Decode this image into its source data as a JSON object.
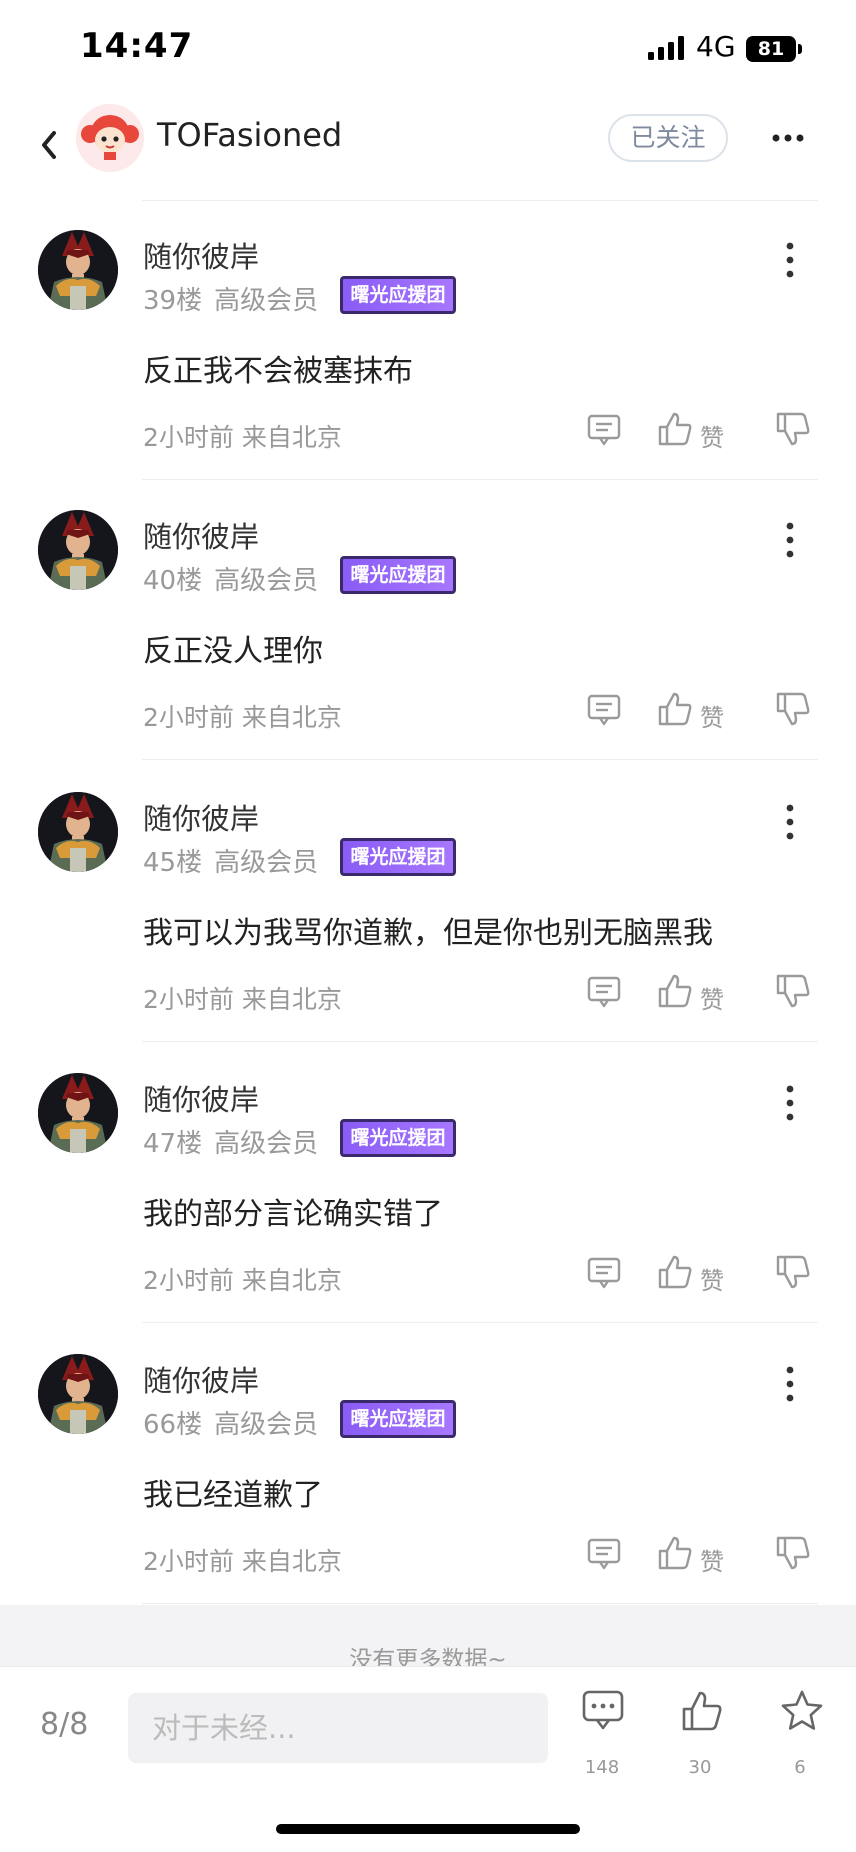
{
  "status_bar": {
    "time": "14:47",
    "network": "4G",
    "battery": "81"
  },
  "header": {
    "title": "TOFasioned",
    "follow_label": "已关注"
  },
  "comments": [
    {
      "author": "随你彼岸",
      "floor": "39楼",
      "level": "高级会员",
      "badge": "曙光应援团",
      "text": "反正我不会被塞抹布",
      "time": "2小时前 来自北京",
      "like_label": "赞"
    },
    {
      "author": "随你彼岸",
      "floor": "40楼",
      "level": "高级会员",
      "badge": "曙光应援团",
      "text": "反正没人理你",
      "time": "2小时前 来自北京",
      "like_label": "赞"
    },
    {
      "author": "随你彼岸",
      "floor": "45楼",
      "level": "高级会员",
      "badge": "曙光应援团",
      "text": "我可以为我骂你道歉，但是你也别无脑黑我",
      "time": "2小时前 来自北京",
      "like_label": "赞"
    },
    {
      "author": "随你彼岸",
      "floor": "47楼",
      "level": "高级会员",
      "badge": "曙光应援团",
      "text": "我的部分言论确实错了",
      "time": "2小时前 来自北京",
      "like_label": "赞"
    },
    {
      "author": "随你彼岸",
      "floor": "66楼",
      "level": "高级会员",
      "badge": "曙光应援团",
      "text": "我已经道歉了",
      "time": "2小时前 来自北京",
      "like_label": "赞"
    }
  ],
  "no_more": "没有更多数据~",
  "bottom_bar": {
    "page": "8/8",
    "input_placeholder": "对于未经...",
    "comments_count": "148",
    "likes_count": "30",
    "favorites_count": "6"
  }
}
